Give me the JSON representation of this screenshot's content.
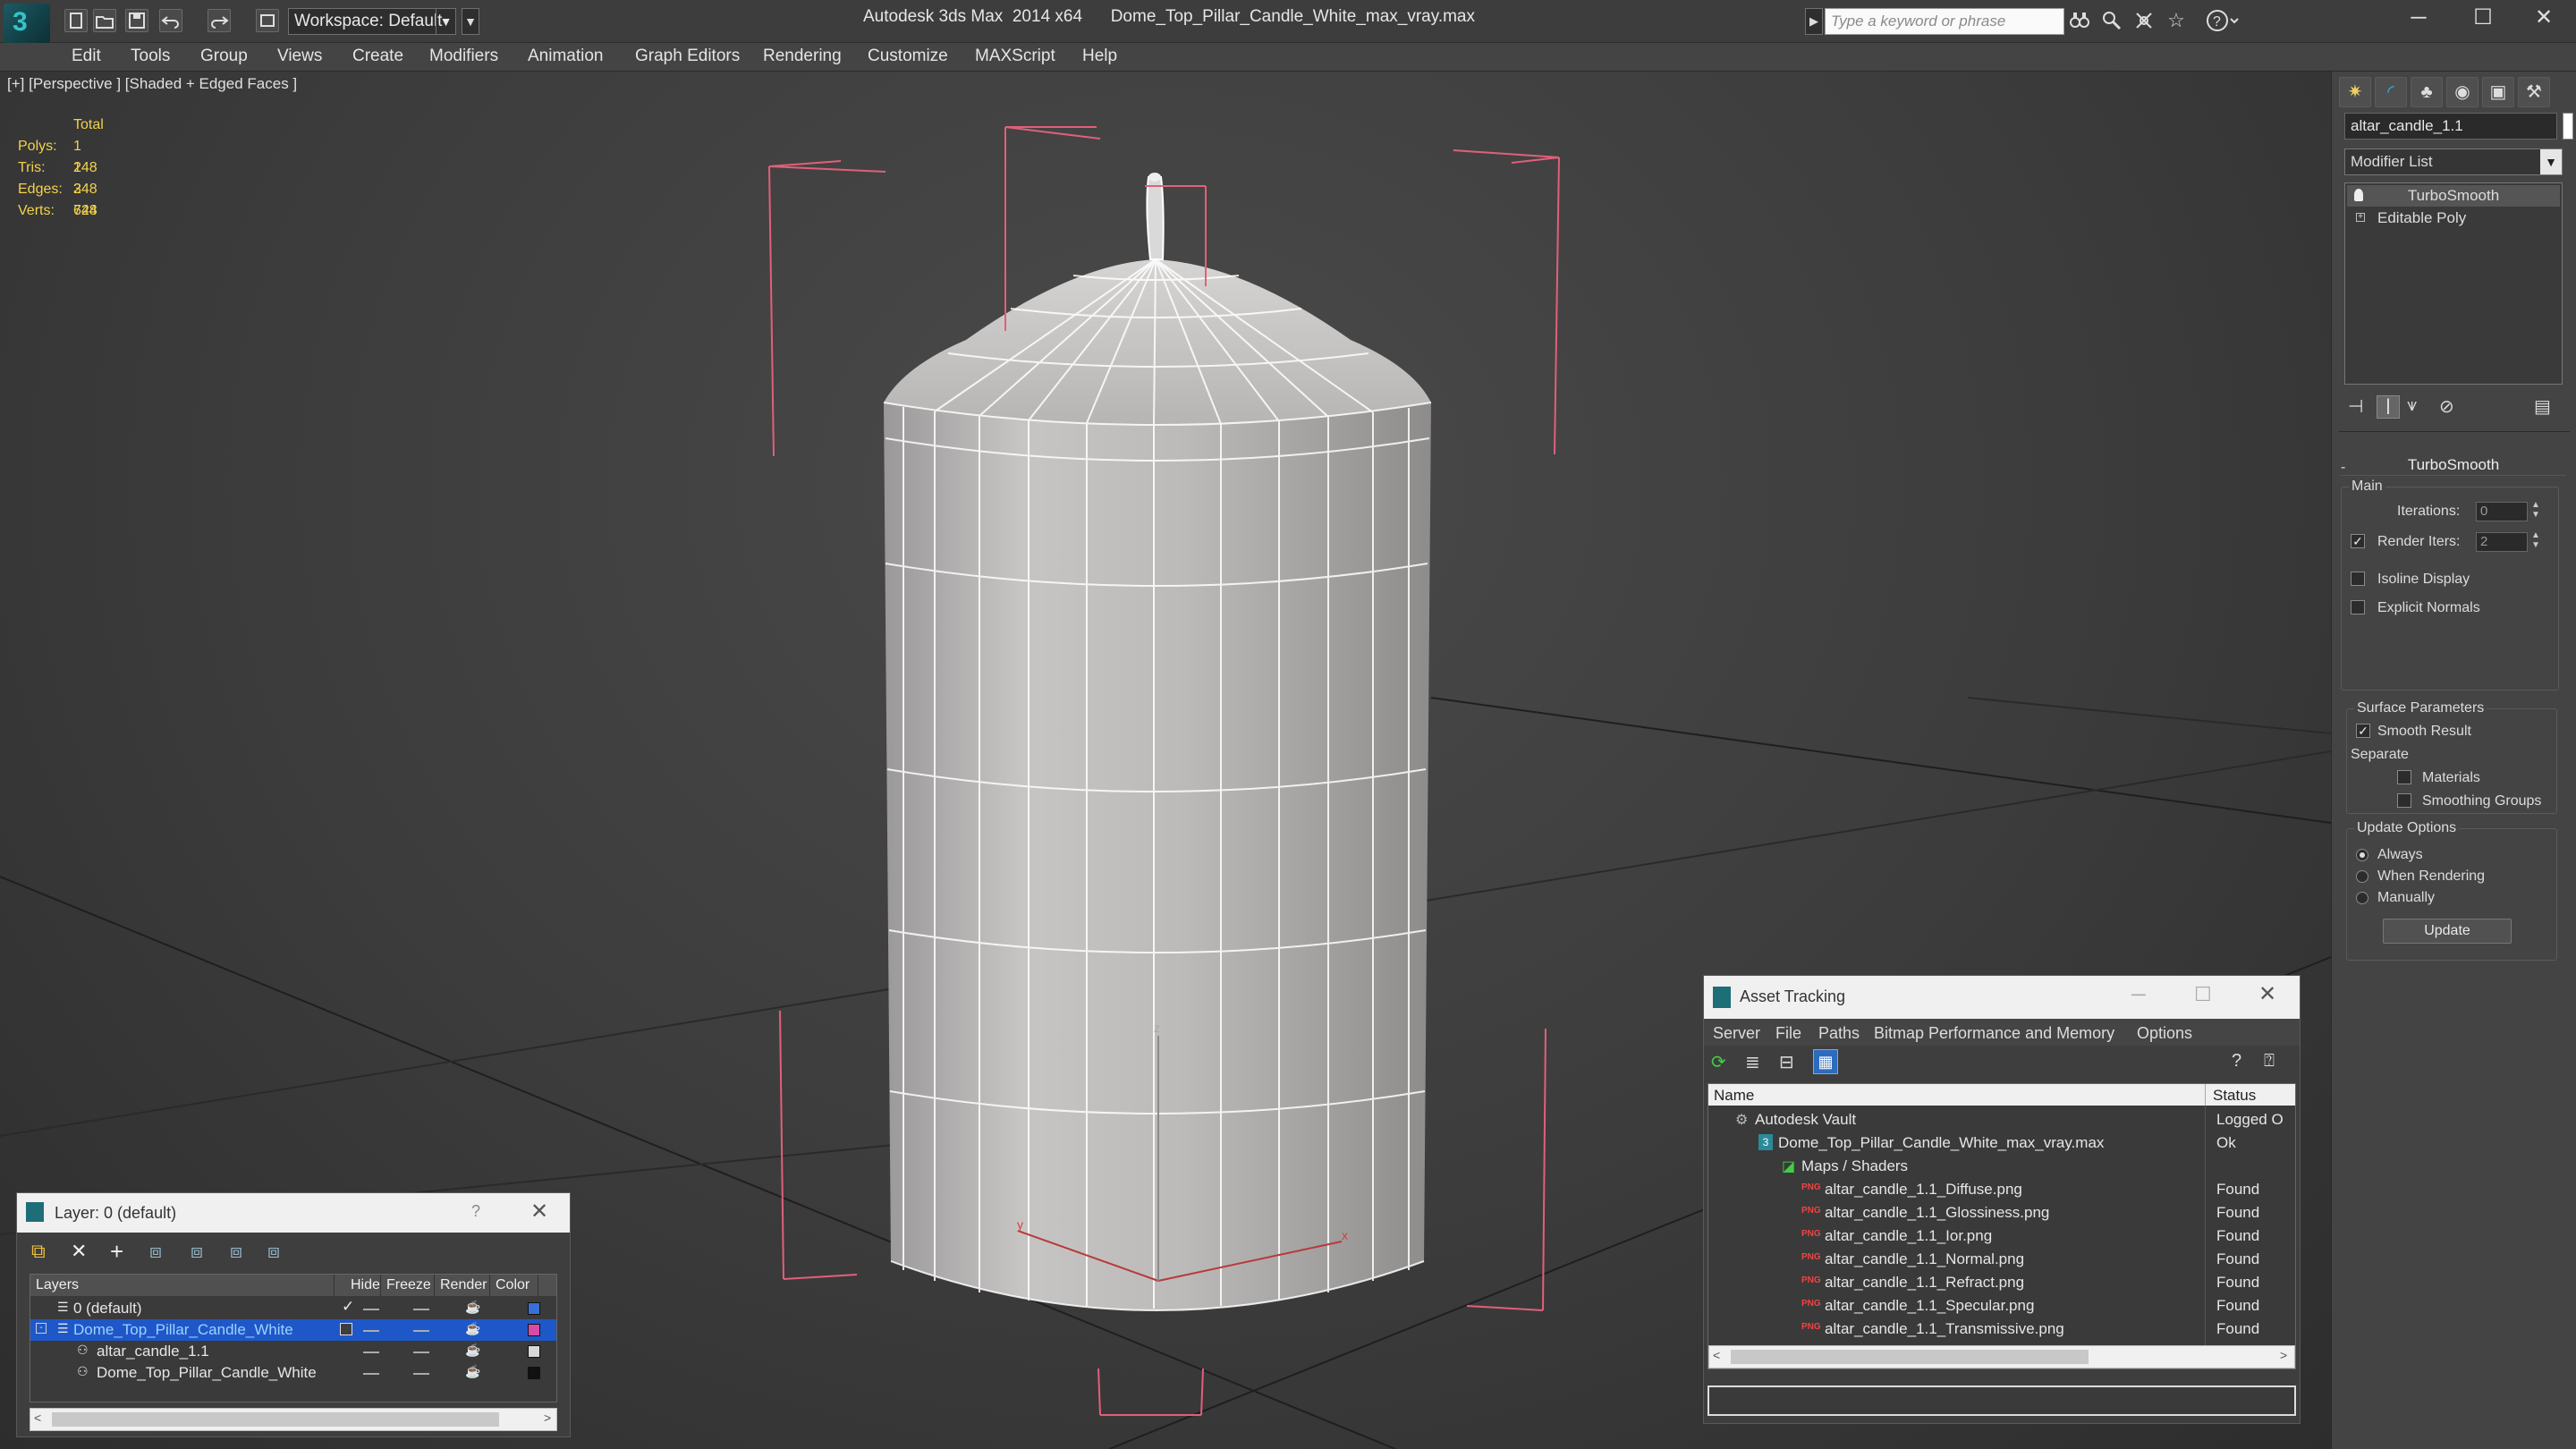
{
  "app": {
    "title": "Autodesk 3ds Max  2014 x64      Dome_Top_Pillar_Candle_White_max_vray.max",
    "workspace": "Workspace: Default",
    "search_placeholder": "Type a keyword or phrase",
    "logo_glyph": "3"
  },
  "menu": [
    "Edit",
    "Tools",
    "Group",
    "Views",
    "Create",
    "Modifiers",
    "Animation",
    "Graph Editors",
    "Rendering",
    "Customize",
    "MAXScript",
    "Help"
  ],
  "viewport": {
    "label": "[+] [Perspective ] [Shaded + Edged Faces ]",
    "stats_header": "Total",
    "stats": [
      {
        "label": "Polys:",
        "value": "1 248"
      },
      {
        "label": "Tris:",
        "value": "1 248"
      },
      {
        "label": "Edges:",
        "value": "3 744"
      },
      {
        "label": "Verts:",
        "value": "628"
      }
    ],
    "gizmo": {
      "x": "x",
      "y": "y",
      "z": "z"
    }
  },
  "command_panel": {
    "object_name": "altar_candle_1.1",
    "modifier_list": "Modifier List",
    "stack": [
      "TurboSmooth",
      "Editable Poly"
    ],
    "rollout_title": "TurboSmooth",
    "main_group": "Main",
    "iterations_label": "Iterations:",
    "iterations_value": "0",
    "render_iters_label": "Render Iters:",
    "render_iters_value": "2",
    "render_iters_checked": true,
    "isoline_display": "Isoline Display",
    "explicit_normals": "Explicit Normals",
    "surface_group": "Surface Parameters",
    "smooth_result": "Smooth Result",
    "separate": "Separate",
    "materials": "Materials",
    "smoothing_groups": "Smoothing Groups",
    "update_group": "Update Options",
    "always": "Always",
    "when_rendering": "When Rendering",
    "manually": "Manually",
    "update_button": "Update"
  },
  "layer_window": {
    "title": "Layer: 0 (default)",
    "help": "?",
    "columns": [
      "Layers",
      "Hide",
      "Freeze",
      "Render",
      "Color"
    ],
    "rows": [
      {
        "name": "0 (default)",
        "indent": 0,
        "color": "#3a6fd8"
      },
      {
        "name": "Dome_Top_Pillar_Candle_White",
        "indent": 0,
        "selected": true,
        "color": "#d84aa8"
      },
      {
        "name": "altar_candle_1.1",
        "indent": 1,
        "color": "#d8d8d8"
      },
      {
        "name": "Dome_Top_Pillar_Candle_White",
        "indent": 1,
        "color": "#111111"
      }
    ]
  },
  "asset_window": {
    "title": "Asset Tracking",
    "menu": [
      "Server",
      "File",
      "Paths",
      "Bitmap Performance and Memory",
      "Options"
    ],
    "columns": [
      "Name",
      "Status"
    ],
    "rows": [
      {
        "name": "Autodesk Vault",
        "status": "Logged O",
        "indent": 0
      },
      {
        "name": "Dome_Top_Pillar_Candle_White_max_vray.max",
        "status": "Ok",
        "indent": 1
      },
      {
        "name": "Maps / Shaders",
        "status": "",
        "indent": 2
      },
      {
        "name": "altar_candle_1.1_Diffuse.png",
        "status": "Found",
        "indent": 3
      },
      {
        "name": "altar_candle_1.1_Glossiness.png",
        "status": "Found",
        "indent": 3
      },
      {
        "name": "altar_candle_1.1_Ior.png",
        "status": "Found",
        "indent": 3
      },
      {
        "name": "altar_candle_1.1_Normal.png",
        "status": "Found",
        "indent": 3
      },
      {
        "name": "altar_candle_1.1_Refract.png",
        "status": "Found",
        "indent": 3
      },
      {
        "name": "altar_candle_1.1_Specular.png",
        "status": "Found",
        "indent": 3
      },
      {
        "name": "altar_candle_1.1_Transmissive.png",
        "status": "Found",
        "indent": 3
      }
    ]
  }
}
